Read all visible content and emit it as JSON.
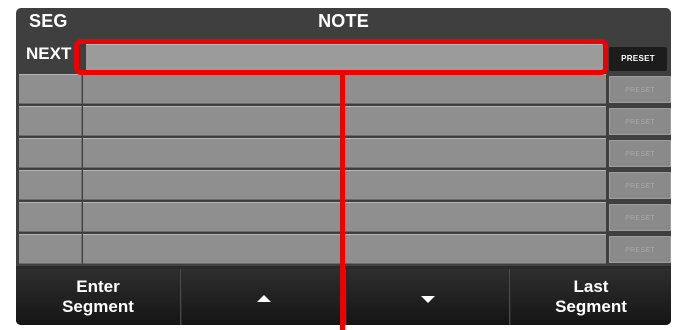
{
  "header": {
    "seg_label": "SEG",
    "note_label": "NOTE"
  },
  "next_row": {
    "label": "NEXT",
    "value": "",
    "preset_label": "PRESET"
  },
  "segment_rows": [
    {
      "seg": "",
      "note": "",
      "preset_label": "PRESET"
    },
    {
      "seg": "",
      "note": "",
      "preset_label": "PRESET"
    },
    {
      "seg": "",
      "note": "",
      "preset_label": "PRESET"
    },
    {
      "seg": "",
      "note": "",
      "preset_label": "PRESET"
    },
    {
      "seg": "",
      "note": "",
      "preset_label": "PRESET"
    },
    {
      "seg": "",
      "note": "",
      "preset_label": "PRESET"
    }
  ],
  "bottom_bar": {
    "enter_line1": "Enter",
    "enter_line2": "Segment",
    "up_icon": "triangle-up",
    "down_icon": "triangle-down",
    "last_line1": "Last",
    "last_line2": "Segment"
  },
  "colors": {
    "highlight": "#ee0000",
    "panel": "#3f3f3f",
    "field": "#9b9b9b"
  }
}
